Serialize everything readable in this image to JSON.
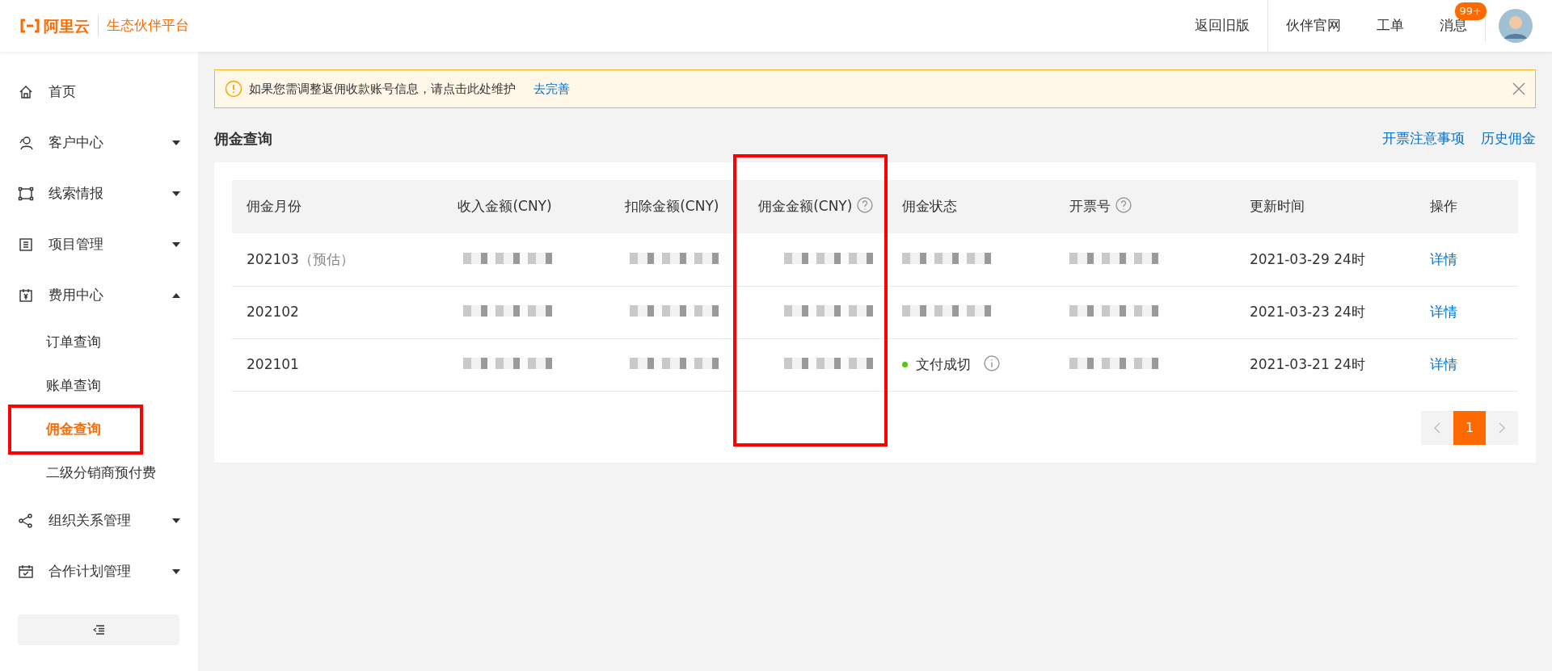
{
  "header": {
    "logo_text": "阿里云",
    "platform": "生态伙伴平台",
    "links": [
      {
        "label": "返回旧版"
      },
      {
        "label": "伙伴官网"
      },
      {
        "label": "工单"
      },
      {
        "label": "消息",
        "badge": "99+"
      }
    ]
  },
  "sidebar": {
    "items": [
      {
        "label": "首页"
      },
      {
        "label": "客户中心",
        "expanded": false
      },
      {
        "label": "线索情报",
        "expanded": false
      },
      {
        "label": "项目管理",
        "expanded": false
      },
      {
        "label": "费用中心",
        "expanded": true,
        "children": [
          {
            "label": "订单查询",
            "selected": false,
            "highlighted": false
          },
          {
            "label": "账单查询",
            "selected": false,
            "highlighted": false
          },
          {
            "label": "佣金查询",
            "selected": true,
            "highlighted": true
          },
          {
            "label": "二级分销商预付费",
            "selected": false,
            "highlighted": false
          }
        ]
      },
      {
        "label": "组织关系管理",
        "expanded": false
      },
      {
        "label": "合作计划管理",
        "expanded": false
      }
    ]
  },
  "alert": {
    "text": "如果您需调整返佣收款账号信息，请点击此处维护",
    "link": "去完善"
  },
  "page_title": "佣金查询",
  "page_links": [
    "开票注意事项",
    "历史佣金"
  ],
  "table": {
    "columns": [
      {
        "label": "佣金月份",
        "help": false,
        "highlighted": false
      },
      {
        "label": "收入金额(CNY)",
        "help": false,
        "highlighted": false
      },
      {
        "label": "扣除金额(CNY)",
        "help": false,
        "highlighted": false
      },
      {
        "label": "佣金金额(CNY)",
        "help": true,
        "highlighted": true
      },
      {
        "label": "佣金状态",
        "help": false,
        "highlighted": false
      },
      {
        "label": "开票号",
        "help": true,
        "highlighted": false
      },
      {
        "label": "更新时间",
        "help": false,
        "highlighted": false
      },
      {
        "label": "操作",
        "help": false,
        "highlighted": false
      }
    ],
    "rows": [
      {
        "cells": [
          {
            "kind": "month",
            "text": "202103",
            "note": "（预估）"
          },
          {
            "kind": "redacted"
          },
          {
            "kind": "redacted"
          },
          {
            "kind": "redacted"
          },
          {
            "kind": "redacted"
          },
          {
            "kind": "redacted"
          },
          {
            "kind": "text",
            "text": "2021-03-29 24时"
          },
          {
            "kind": "link",
            "text": "详情"
          }
        ]
      },
      {
        "cells": [
          {
            "kind": "month",
            "text": "202102"
          },
          {
            "kind": "redacted"
          },
          {
            "kind": "redacted"
          },
          {
            "kind": "redacted"
          },
          {
            "kind": "redacted"
          },
          {
            "kind": "redacted"
          },
          {
            "kind": "text",
            "text": "2021-03-23 24时"
          },
          {
            "kind": "link",
            "text": "详情"
          }
        ]
      },
      {
        "cells": [
          {
            "kind": "month",
            "text": "202101"
          },
          {
            "kind": "redacted"
          },
          {
            "kind": "redacted"
          },
          {
            "kind": "redacted"
          },
          {
            "kind": "status",
            "text": "文付成切",
            "color": "#52c41a"
          },
          {
            "kind": "redacted"
          },
          {
            "kind": "text",
            "text": "2021-03-21 24时"
          },
          {
            "kind": "link",
            "text": "详情"
          }
        ]
      }
    ]
  },
  "pagination": {
    "pages": [
      {
        "label": "1",
        "selected": true
      }
    ]
  }
}
